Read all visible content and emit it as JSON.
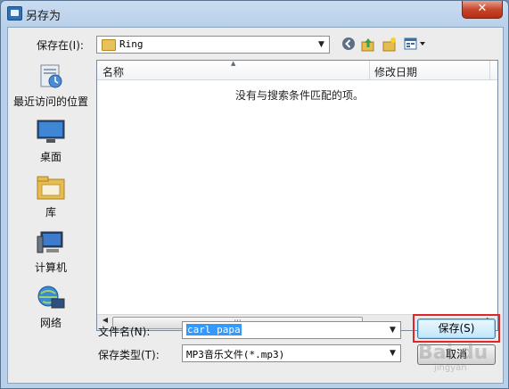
{
  "window": {
    "title": "另存为",
    "close_glyph": "✕"
  },
  "save_in": {
    "label": "保存在(I):",
    "value": "Ring"
  },
  "toolbar": {
    "back_icon": "back-arrow-icon",
    "up_icon": "up-folder-icon",
    "new_folder_icon": "new-folder-icon",
    "view_menu_icon": "view-menu-icon"
  },
  "places": [
    {
      "label": "最近访问的位置",
      "icon": "recent-places-icon"
    },
    {
      "label": "桌面",
      "icon": "desktop-icon"
    },
    {
      "label": "库",
      "icon": "libraries-icon"
    },
    {
      "label": "计算机",
      "icon": "computer-icon"
    },
    {
      "label": "网络",
      "icon": "network-icon"
    }
  ],
  "file_list": {
    "columns": [
      "名称",
      "修改日期"
    ],
    "empty_message": "没有与搜索条件匹配的项。"
  },
  "file_name": {
    "label": "文件名(N):",
    "value": "carl papa"
  },
  "file_type": {
    "label": "保存类型(T):",
    "value": "MP3音乐文件(*.mp3)"
  },
  "buttons": {
    "save": "保存(S)",
    "cancel": "取消"
  },
  "watermark": {
    "text": "Bai du",
    "sub": "jingyan"
  },
  "colors": {
    "highlight_box": "#e0262b",
    "selection": "#3399ff"
  }
}
